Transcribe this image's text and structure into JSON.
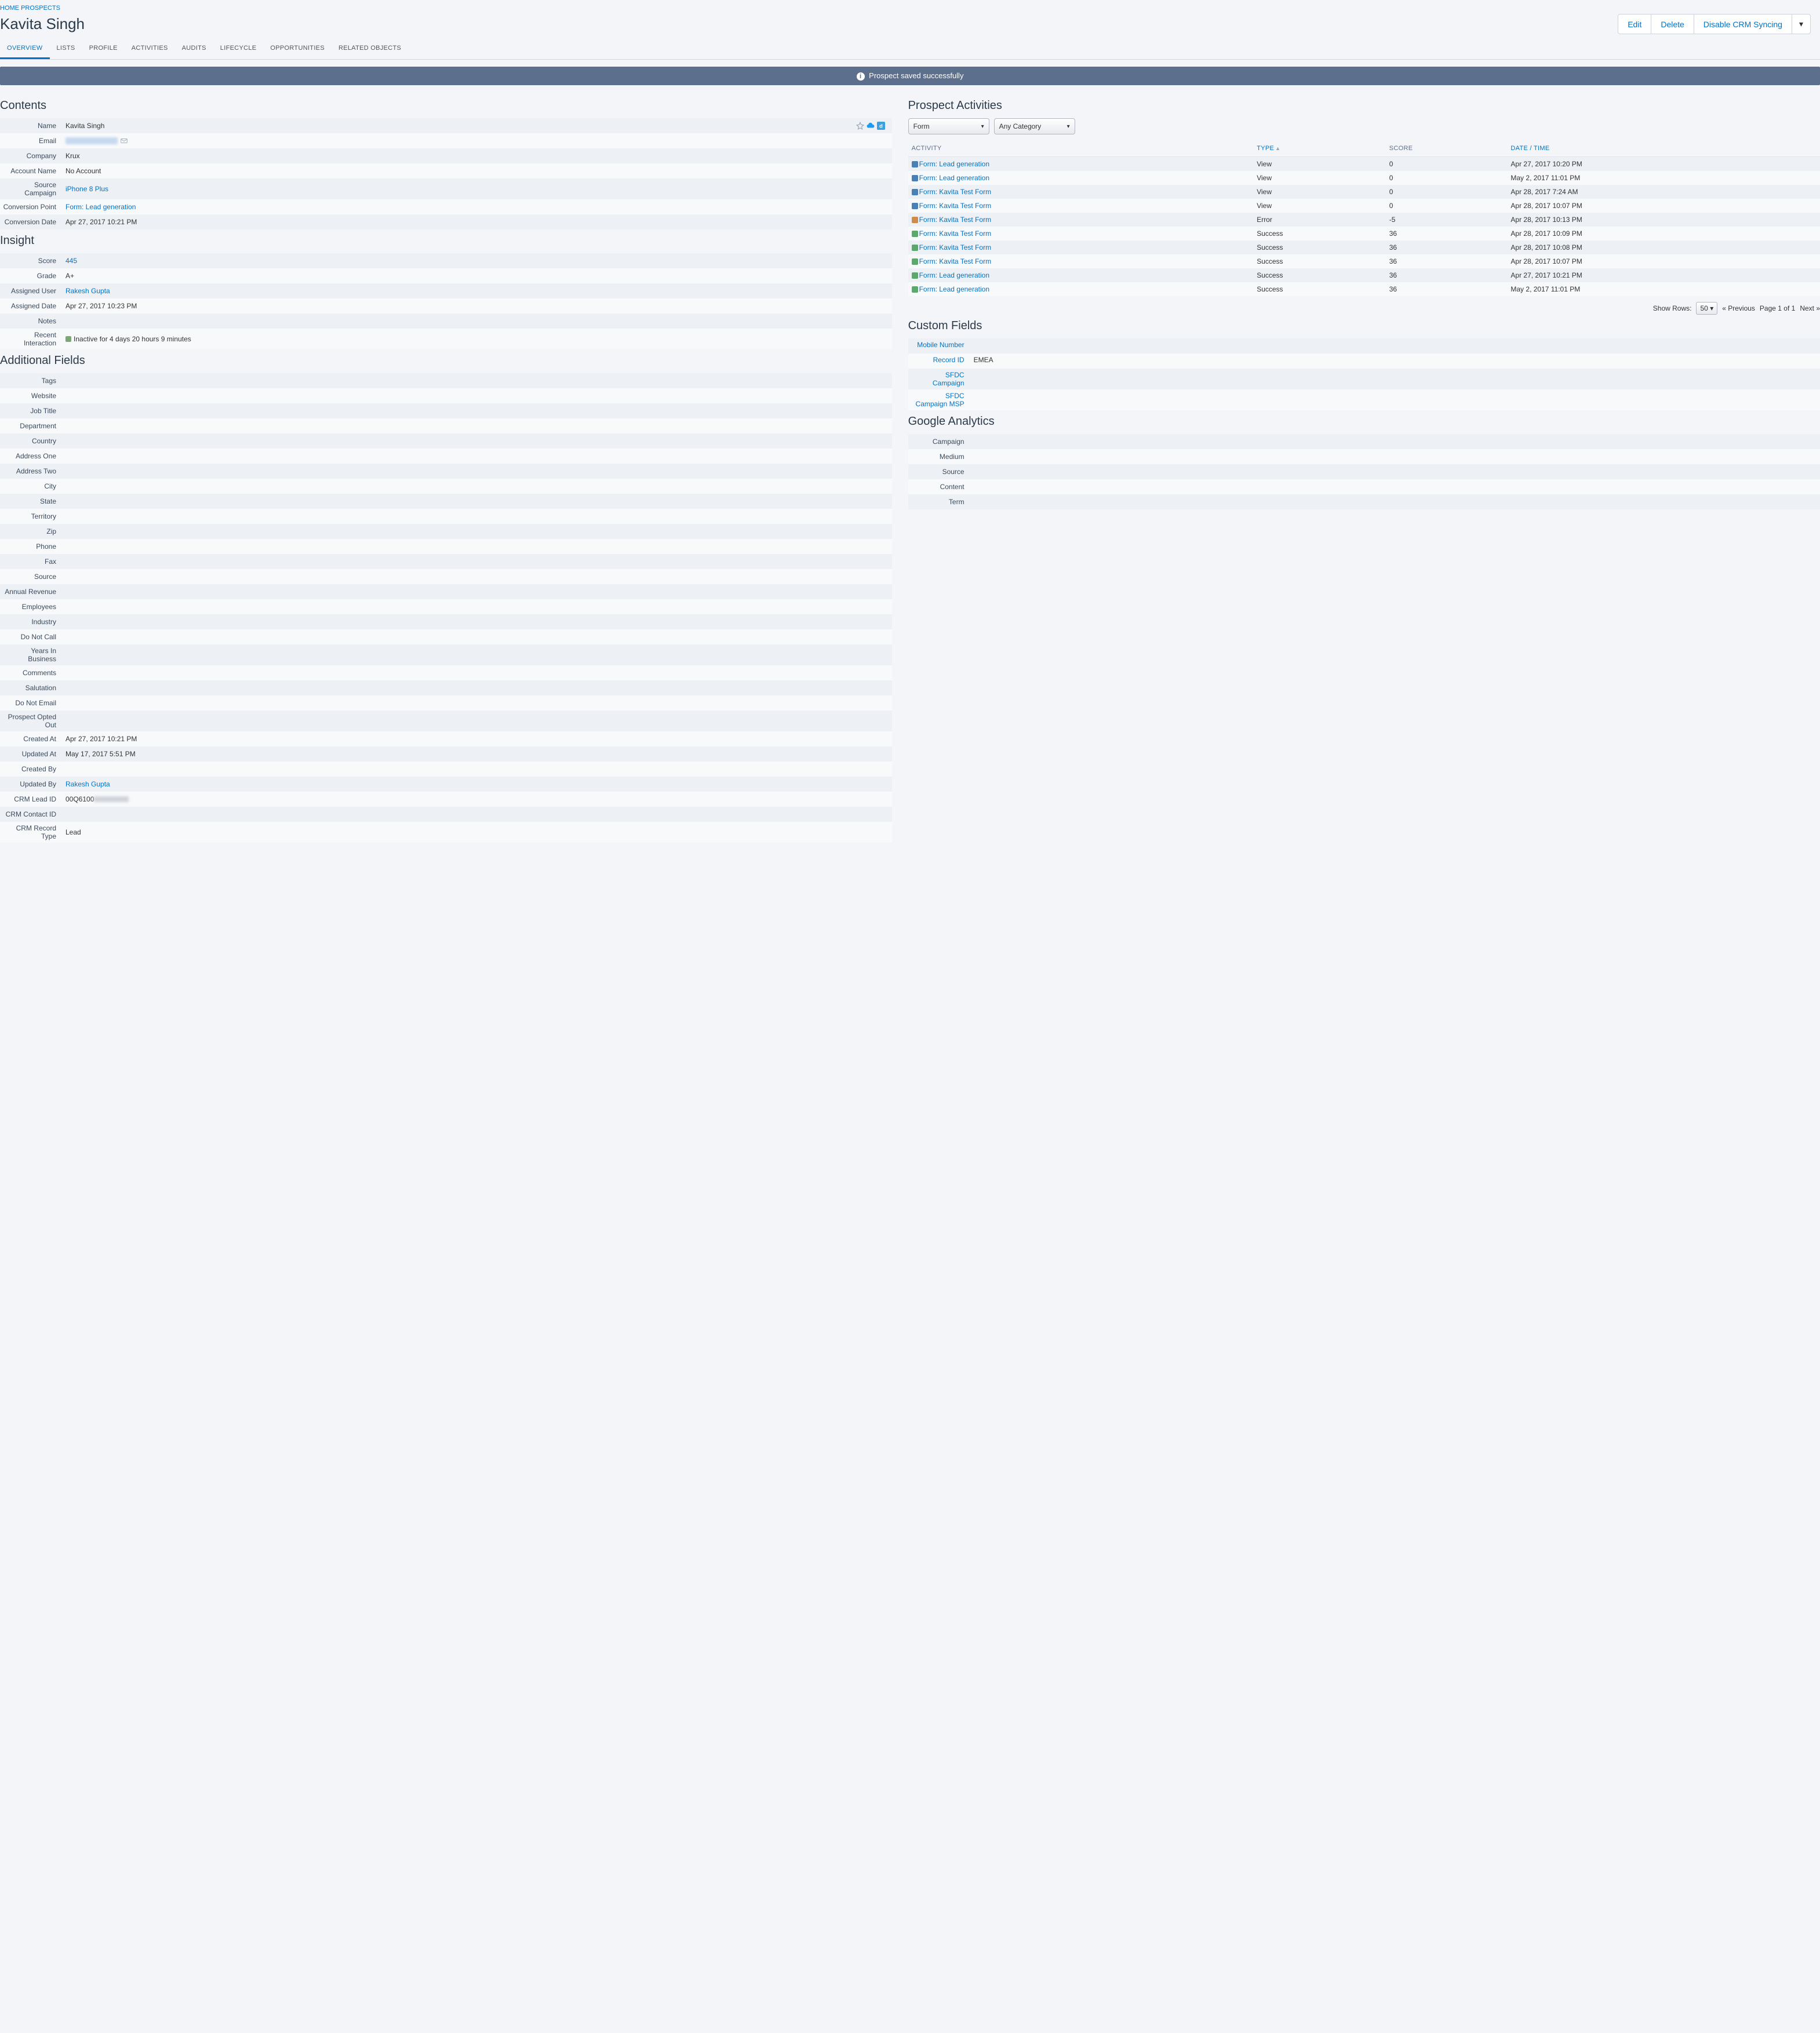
{
  "breadcrumb": [
    "HOME",
    "PROSPECTS"
  ],
  "page_title": "Kavita Singh",
  "actions": {
    "edit": "Edit",
    "delete": "Delete",
    "disable_sync": "Disable CRM Syncing"
  },
  "tabs": [
    "OVERVIEW",
    "LISTS",
    "PROFILE",
    "ACTIVITIES",
    "AUDITS",
    "LIFECYCLE",
    "OPPORTUNITIES",
    "RELATED OBJECTS"
  ],
  "active_tab": 0,
  "banner": "Prospect saved successfully",
  "sections": {
    "contents_title": "Contents",
    "insight_title": "Insight",
    "additional_title": "Additional Fields",
    "activities_title": "Prospect Activities",
    "custom_fields_title": "Custom Fields",
    "ga_title": "Google Analytics"
  },
  "contents": {
    "name_label": "Name",
    "name": "Kavita Singh",
    "email_label": "Email",
    "email_hidden": true,
    "company_label": "Company",
    "company": "Krux",
    "account_name_label": "Account Name",
    "account_name": "No Account",
    "source_campaign_label": "Source Campaign",
    "source_campaign": "iPhone 8 Plus",
    "conversion_point_label": "Conversion Point",
    "conversion_point": "Form: Lead generation",
    "conversion_date_label": "Conversion Date",
    "conversion_date": "Apr 27, 2017 10:21 PM"
  },
  "insight": {
    "score_label": "Score",
    "score": "445",
    "grade_label": "Grade",
    "grade": "A+",
    "assigned_user_label": "Assigned User",
    "assigned_user": "Rakesh Gupta",
    "assigned_date_label": "Assigned Date",
    "assigned_date": "Apr 27, 2017 10:23 PM",
    "notes_label": "Notes",
    "notes": "",
    "recent_interaction_label": "Recent Interaction",
    "recent_interaction": "Inactive for 4 days 20 hours 9 minutes"
  },
  "additional": [
    {
      "label": "Tags",
      "value": ""
    },
    {
      "label": "Website",
      "value": ""
    },
    {
      "label": "Job Title",
      "value": ""
    },
    {
      "label": "Department",
      "value": ""
    },
    {
      "label": "Country",
      "value": ""
    },
    {
      "label": "Address One",
      "value": ""
    },
    {
      "label": "Address Two",
      "value": ""
    },
    {
      "label": "City",
      "value": ""
    },
    {
      "label": "State",
      "value": ""
    },
    {
      "label": "Territory",
      "value": ""
    },
    {
      "label": "Zip",
      "value": ""
    },
    {
      "label": "Phone",
      "value": ""
    },
    {
      "label": "Fax",
      "value": ""
    },
    {
      "label": "Source",
      "value": ""
    },
    {
      "label": "Annual Revenue",
      "value": ""
    },
    {
      "label": "Employees",
      "value": ""
    },
    {
      "label": "Industry",
      "value": ""
    },
    {
      "label": "Do Not Call",
      "value": ""
    },
    {
      "label": "Years In Business",
      "value": ""
    },
    {
      "label": "Comments",
      "value": ""
    },
    {
      "label": "Salutation",
      "value": ""
    },
    {
      "label": "Do Not Email",
      "value": ""
    },
    {
      "label": "Prospect Opted Out",
      "value": ""
    },
    {
      "label": "Created At",
      "value": "Apr 27, 2017 10:21 PM"
    },
    {
      "label": "Updated At",
      "value": "May 17, 2017 5:51 PM"
    },
    {
      "label": "Created By",
      "value": ""
    },
    {
      "label": "Updated By",
      "value": "Rakesh Gupta",
      "link": true
    },
    {
      "label": "CRM Lead ID",
      "value": "00Q6100",
      "redacted_tail": true
    },
    {
      "label": "CRM Contact ID",
      "value": ""
    },
    {
      "label": "CRM Record Type",
      "value": "Lead"
    }
  ],
  "activity_selects": {
    "type": "Form",
    "category": "Any Category"
  },
  "activity_columns": {
    "activity": "ACTIVITY",
    "type": "TYPE",
    "score": "SCORE",
    "date": "DATE / TIME"
  },
  "activities": [
    {
      "icon": "blue",
      "name": "Form: Lead generation",
      "type": "View",
      "score": "0",
      "date": "Apr 27, 2017 10:20 PM"
    },
    {
      "icon": "blue",
      "name": "Form: Lead generation",
      "type": "View",
      "score": "0",
      "date": "May 2, 2017 11:01 PM"
    },
    {
      "icon": "blue",
      "name": "Form: Kavita Test Form",
      "type": "View",
      "score": "0",
      "date": "Apr 28, 2017 7:24 AM"
    },
    {
      "icon": "blue",
      "name": "Form: Kavita Test Form",
      "type": "View",
      "score": "0",
      "date": "Apr 28, 2017 10:07 PM"
    },
    {
      "icon": "orange",
      "name": "Form: Kavita Test Form",
      "type": "Error",
      "score": "-5",
      "date": "Apr 28, 2017 10:13 PM"
    },
    {
      "icon": "green",
      "name": "Form: Kavita Test Form",
      "type": "Success",
      "score": "36",
      "date": "Apr 28, 2017 10:09 PM"
    },
    {
      "icon": "green",
      "name": "Form: Kavita Test Form",
      "type": "Success",
      "score": "36",
      "date": "Apr 28, 2017 10:08 PM"
    },
    {
      "icon": "green",
      "name": "Form: Kavita Test Form",
      "type": "Success",
      "score": "36",
      "date": "Apr 28, 2017 10:07 PM"
    },
    {
      "icon": "green",
      "name": "Form: Lead generation",
      "type": "Success",
      "score": "36",
      "date": "Apr 27, 2017 10:21 PM"
    },
    {
      "icon": "green",
      "name": "Form: Lead generation",
      "type": "Success",
      "score": "36",
      "date": "May 2, 2017 11:01 PM"
    }
  ],
  "pagination": {
    "show_rows_label": "Show Rows:",
    "rows": "50",
    "prev": "« Previous",
    "page_label": "Page 1  of 1",
    "next": "Next »"
  },
  "custom_fields": [
    {
      "label": "Mobile Number",
      "value": ""
    },
    {
      "label": "Record ID",
      "value": "EMEA"
    },
    {
      "label": "SFDC Campaign",
      "value": ""
    },
    {
      "label": "SFDC Campaign MSP",
      "value": ""
    }
  ],
  "ga": [
    {
      "label": "Campaign",
      "value": ""
    },
    {
      "label": "Medium",
      "value": ""
    },
    {
      "label": "Source",
      "value": ""
    },
    {
      "label": "Content",
      "value": ""
    },
    {
      "label": "Term",
      "value": ""
    }
  ]
}
